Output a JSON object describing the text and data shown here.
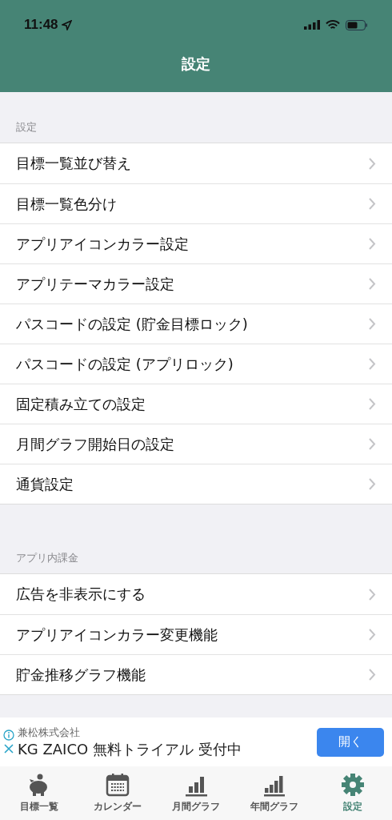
{
  "status_bar": {
    "time": "11:48"
  },
  "nav": {
    "title": "設定"
  },
  "sections": [
    {
      "header": "設定",
      "items": [
        "目標一覧並び替え",
        "目標一覧色分け",
        "アプリアイコンカラー設定",
        "アプリテーマカラー設定",
        "パスコードの設定 (貯金目標ロック)",
        "パスコードの設定 (アプリロック)",
        "固定積み立ての設定",
        "月間グラフ開始日の設定",
        "通貨設定"
      ]
    },
    {
      "header": "アプリ内課金",
      "items": [
        "広告を非表示にする",
        "アプリアイコンカラー変更機能",
        "貯金推移グラフ機能"
      ]
    }
  ],
  "ad": {
    "advertiser": "兼松株式会社",
    "headline": "KG ZAICO 無料トライアル 受付中",
    "button": "開く"
  },
  "tabs": [
    {
      "kind": "piggy",
      "label": "目標一覧",
      "selected": false
    },
    {
      "kind": "calendar",
      "label": "カレンダー",
      "selected": false
    },
    {
      "kind": "monthly",
      "label": "月間グラフ",
      "selected": false
    },
    {
      "kind": "yearly",
      "label": "年間グラフ",
      "selected": false
    },
    {
      "kind": "gear",
      "label": "設定",
      "selected": true
    }
  ]
}
